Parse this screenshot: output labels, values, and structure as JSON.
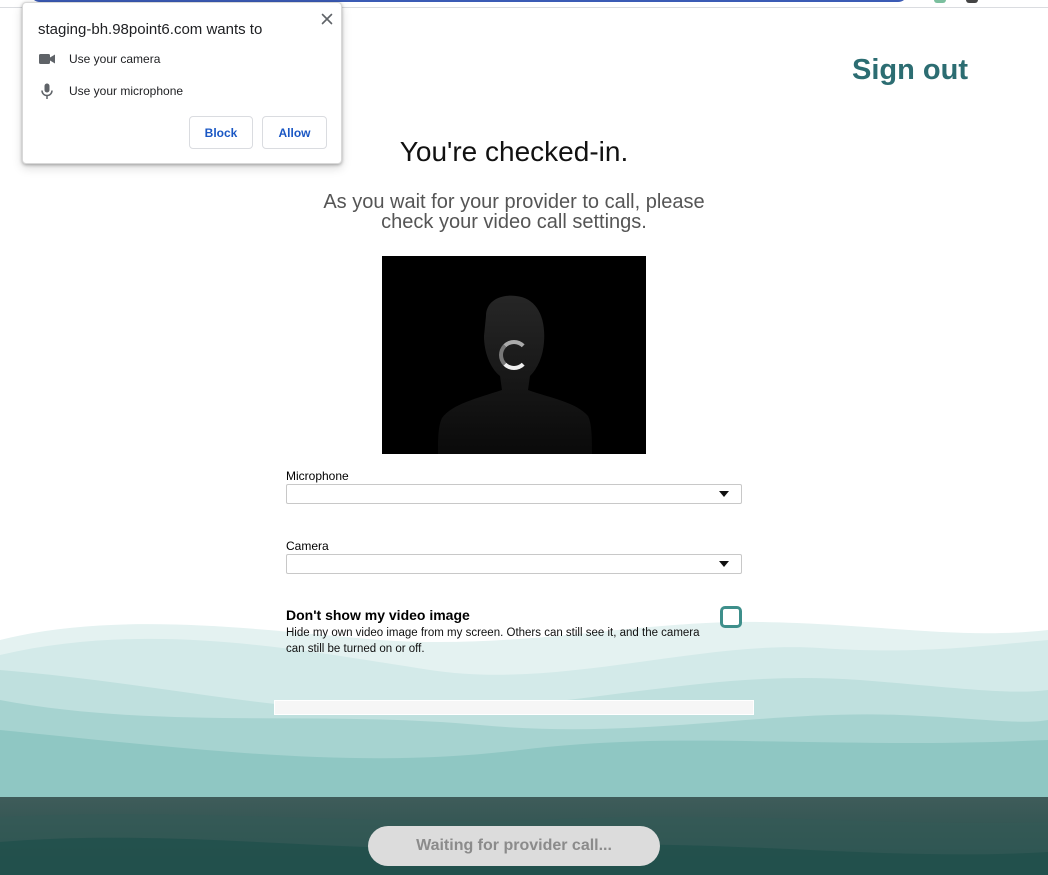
{
  "popup": {
    "title": "staging-bh.98point6.com wants to",
    "items": [
      {
        "label": "Use your camera",
        "icon": "camera-icon"
      },
      {
        "label": "Use your microphone",
        "icon": "microphone-icon"
      }
    ],
    "block_label": "Block",
    "allow_label": "Allow",
    "close_icon": "close-icon"
  },
  "header": {
    "sign_out_label": "Sign out"
  },
  "main": {
    "title": "You're checked-in.",
    "subtitle": "As you wait for your provider to call, please check your video call settings.",
    "microphone": {
      "label": "Microphone",
      "value": ""
    },
    "camera": {
      "label": "Camera",
      "value": ""
    },
    "hide_video": {
      "title": "Don't show my video image",
      "description": "Hide my own video image from my screen. Others can still see it, and the camera can still be turned on or off.",
      "checked": false
    }
  },
  "footer": {
    "waiting_label": "Waiting for provider call..."
  },
  "colors": {
    "accent": "#2c6d72",
    "checkbox_border": "#3e8f8b",
    "button_text": "#1a57c4",
    "wave_light": "#c7e3e2",
    "wave_dark": "#2f5451"
  }
}
